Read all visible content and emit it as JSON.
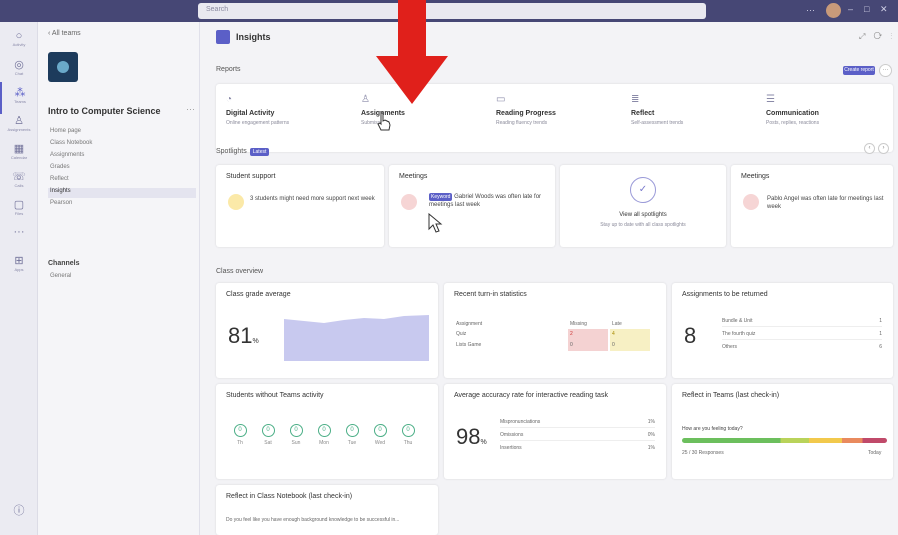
{
  "titlebar": {
    "search_placeholder": "Search",
    "more": "···",
    "win_controls": [
      "–",
      "□",
      "✕"
    ]
  },
  "rail": [
    {
      "icon": "bell-icon",
      "glyph": "🔔",
      "label": "Activity"
    },
    {
      "icon": "chat-icon",
      "glyph": "💬",
      "label": "Chat"
    },
    {
      "icon": "teams-icon",
      "glyph": "👥",
      "label": "Teams",
      "active": true
    },
    {
      "icon": "assignments-icon",
      "glyph": "🎒",
      "label": "Assignments"
    },
    {
      "icon": "calendar-icon",
      "glyph": "📅",
      "label": "Calendar"
    },
    {
      "icon": "calls-icon",
      "glyph": "📞",
      "label": "Calls"
    },
    {
      "icon": "files-icon",
      "glyph": "📄",
      "label": "Files"
    },
    {
      "icon": "more-icon",
      "glyph": "···",
      "label": ""
    },
    {
      "icon": "apps-icon",
      "glyph": "▦",
      "label": "Apps"
    }
  ],
  "teampanel": {
    "back_label": "All teams",
    "team_name": "Intro to Computer Science",
    "items": [
      "Home page",
      "Class Notebook",
      "Assignments",
      "Grades",
      "Reflect",
      "Insights",
      "Pearson"
    ],
    "active_index": 5,
    "channels_heading": "Channels",
    "channel_general": "General"
  },
  "page": {
    "title": "Insights"
  },
  "reports": {
    "heading": "Reports",
    "create_label": "Create report",
    "items": [
      {
        "title": "Digital Activity",
        "subtitle": "Online engagement patterns"
      },
      {
        "title": "Assignments",
        "subtitle": "Submissions"
      },
      {
        "title": "Reading Progress",
        "subtitle": "Reading fluency trends"
      },
      {
        "title": "Reflect",
        "subtitle": "Self-assessment trends"
      },
      {
        "title": "Communication",
        "subtitle": "Posts, replies, reactions"
      }
    ]
  },
  "spotlights": {
    "heading": "Spotlights",
    "badge": "Latest",
    "student_support": {
      "title": "Student support",
      "text": "3 students might need more support next week"
    },
    "meetings": {
      "title": "Meetings",
      "tag": "Keyword",
      "text_rest": "Gabriel Woods was often late for meetings last week"
    },
    "view_all": {
      "title": "View all spotlights",
      "text": "Stay up to date with all class spotlights"
    },
    "meetings2": {
      "title": "Meetings",
      "text": "Pablo Angel was often late for meetings last week"
    }
  },
  "overview": {
    "heading": "Class overview",
    "grade": {
      "title": "Class grade average",
      "value": "81",
      "unit": "%"
    },
    "recent": {
      "title": "Recent turn-in statistics",
      "headers": [
        "Assignment",
        "Missing",
        "Late"
      ],
      "rows": [
        [
          "Quiz",
          "2",
          "4"
        ],
        [
          "Lists Game",
          "0",
          "0"
        ]
      ]
    },
    "volume": {
      "title": "Assignments to be returned",
      "value": "8",
      "rows": [
        [
          "Bundle & Unit",
          "1"
        ],
        [
          "The fourth quiz",
          "1"
        ],
        [
          "Others",
          "6"
        ]
      ]
    },
    "noactivity": {
      "title": "Students without Teams activity",
      "days": [
        "Th",
        "Sat",
        "Sun",
        "Mon",
        "Tue",
        "Wed",
        "Thu"
      ],
      "counts": [
        "0",
        "0",
        "0",
        "0",
        "0",
        "0",
        "0"
      ]
    },
    "accuracy": {
      "title": "Average accuracy rate for interactive reading task",
      "value": "98",
      "unit": "%",
      "rows": [
        [
          "Mispronunciations",
          "1%"
        ],
        [
          "Omissions",
          "0%"
        ],
        [
          "Insertions",
          "1%"
        ]
      ]
    },
    "reflect": {
      "title": "Reflect in Teams (last check-in)",
      "question": "How are you feeling today?",
      "responders": "25 / 30 Responses",
      "link": "Today"
    },
    "notebook": {
      "title": "Reflect in Class Notebook (last check-in)",
      "text": "Do you feel like you have enough background knowledge to be successful in..."
    }
  }
}
